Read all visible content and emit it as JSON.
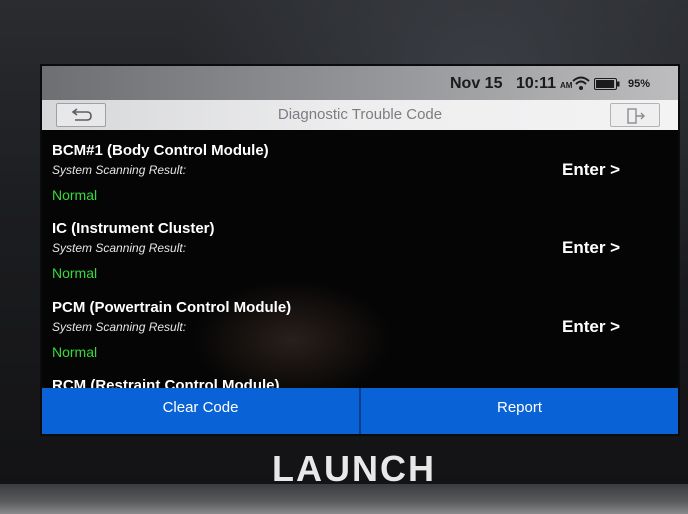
{
  "status_bar": {
    "date": "Nov 15",
    "time": "10:11",
    "am_pm": "AM",
    "battery_percent": "95%",
    "battery_level": 0.95
  },
  "header": {
    "title": "Diagnostic Trouble Code",
    "back_icon": "back-arrow-icon",
    "exit_icon": "exit-icon"
  },
  "modules": [
    {
      "name": "BCM#1 (Body Control Module)",
      "scan_label": "System Scanning Result:",
      "status": "Normal",
      "enter_label": "Enter >"
    },
    {
      "name": "IC (Instrument Cluster)",
      "scan_label": "System Scanning Result:",
      "status": "Normal",
      "enter_label": "Enter >"
    },
    {
      "name": "PCM (Powertrain Control Module)",
      "scan_label": "System Scanning Result:",
      "status": "Normal",
      "enter_label": "Enter >"
    },
    {
      "name": "RCM (Restraint Control Module)"
    }
  ],
  "actions": {
    "clear_code": "Clear Code",
    "report": "Report"
  },
  "brand": "LAUNCH",
  "colors": {
    "accent_blue": "#0a63d6",
    "status_normal": "#38d93a"
  }
}
